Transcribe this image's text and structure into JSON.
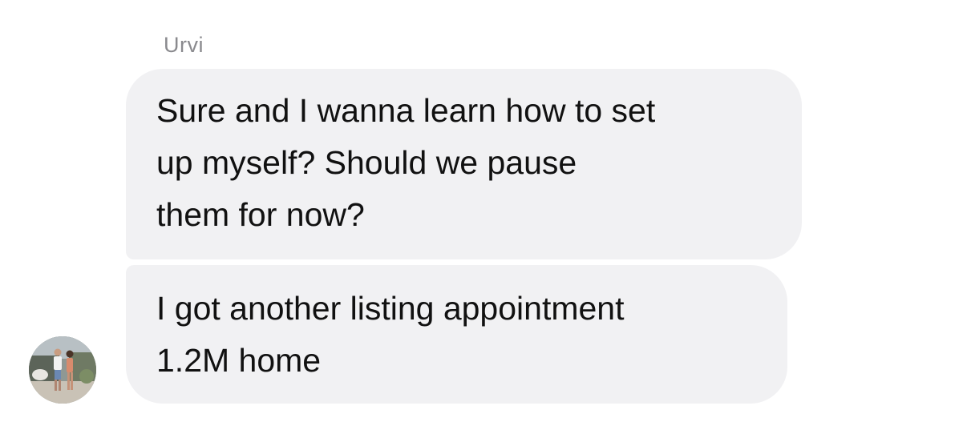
{
  "conversation": {
    "sender_name": "Urvi",
    "messages": [
      {
        "lines": [
          "Sure and I wanna learn how to set",
          "up myself? Should we pause",
          "them for now?"
        ]
      },
      {
        "lines": [
          "I got another listing appointment",
          "1.2M home"
        ]
      }
    ]
  },
  "colors": {
    "bubble_background": "#f1f1f3",
    "sender_name": "#8a8a8e",
    "message_text": "#111111"
  },
  "avatar": {
    "icon": "profile-photo"
  }
}
